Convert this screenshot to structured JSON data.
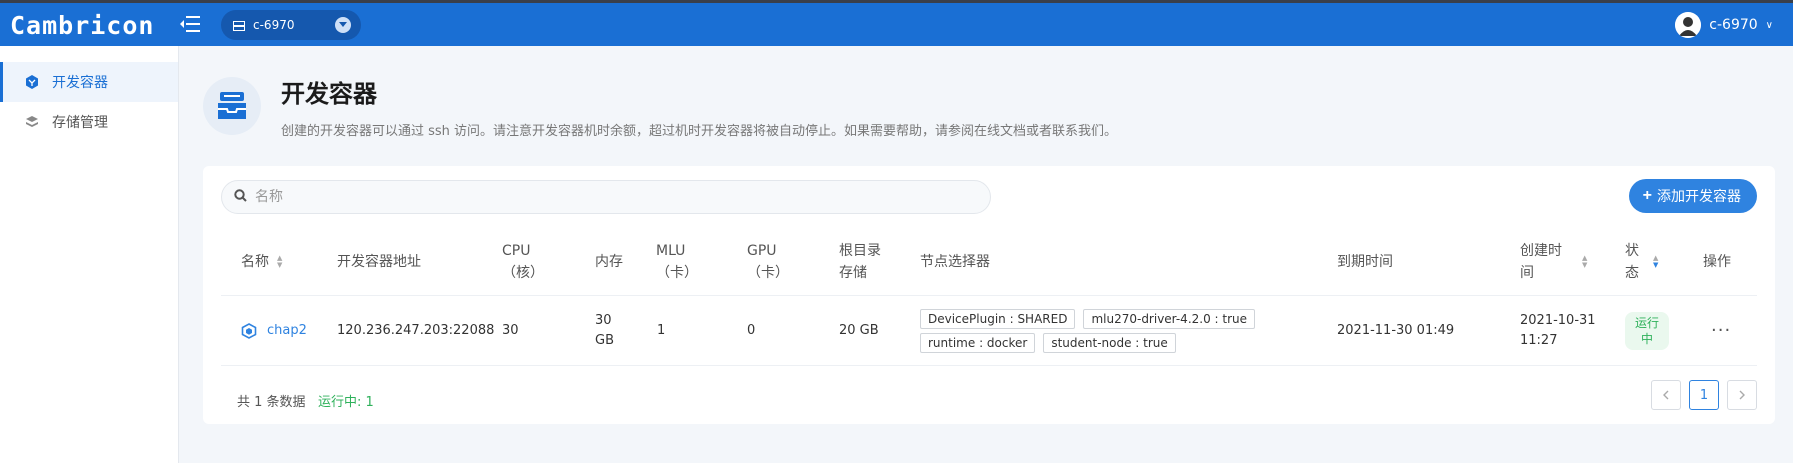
{
  "app": {
    "logo": "Cambricon"
  },
  "header": {
    "cluster": "c-6970",
    "user": "c-6970"
  },
  "sidebar": {
    "items": [
      {
        "label": "开发容器",
        "active": true
      },
      {
        "label": "存储管理",
        "active": false
      }
    ]
  },
  "page": {
    "title": "开发容器",
    "description": "创建的开发容器可以通过 ssh 访问。请注意开发容器机时余额，超过机时开发容器将被自动停止。如果需要帮助，请参阅在线文档或者联系我们。"
  },
  "search": {
    "placeholder": "名称"
  },
  "toolbar": {
    "add_label": "添加开发容器"
  },
  "table": {
    "headers": {
      "name": "名称",
      "address": "开发容器地址",
      "cpu_1": "CPU",
      "cpu_2": "（核）",
      "memory": "内存",
      "mlu_1": "MLU",
      "mlu_2": "（卡）",
      "gpu_1": "GPU",
      "gpu_2": "（卡）",
      "root_1": "根目录",
      "root_2": "存储",
      "node": "节点选择器",
      "expire": "到期时间",
      "created_1": "创建时",
      "created_2": "间",
      "status_1": "状",
      "status_2": "态",
      "actions": "操作"
    },
    "rows": [
      {
        "name": "chap2",
        "address": "120.236.247.203:22088",
        "cpu": "30",
        "memory_1": "30",
        "memory_2": "GB",
        "mlu": "1",
        "gpu": "0",
        "root": "20 GB",
        "tags": [
          "DevicePlugin : SHARED",
          "mlu270-driver-4.2.0 : true",
          "runtime : docker",
          "student-node : true"
        ],
        "expire": "2021-11-30 01:49",
        "created_1": "2021-10-31",
        "created_2": "11:27",
        "status_1": "运行",
        "status_2": "中"
      }
    ]
  },
  "footer": {
    "total": "共 1 条数据",
    "running": "运行中: 1"
  },
  "pagination": {
    "current": "1"
  },
  "colors": {
    "brand": "#1a6fd4",
    "accent": "#2f83e0",
    "success": "#2fb15b"
  }
}
